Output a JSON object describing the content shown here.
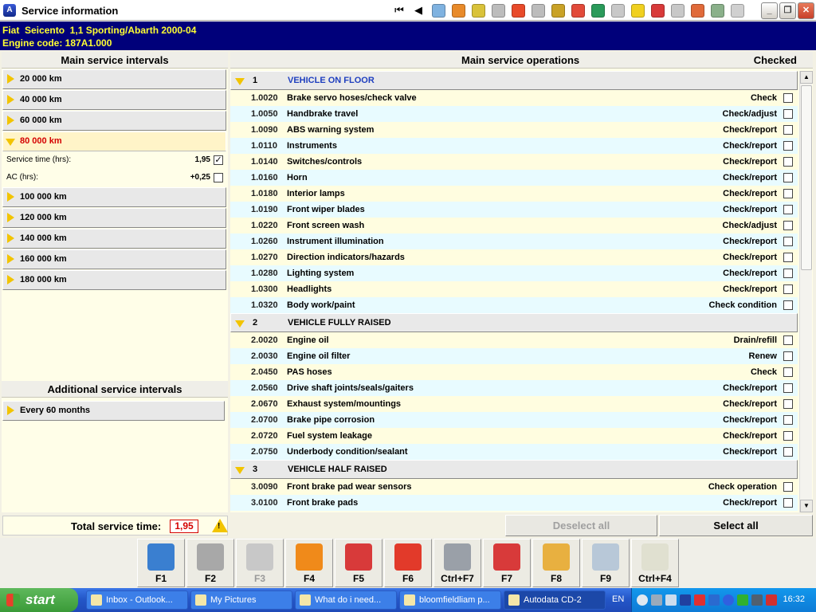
{
  "window": {
    "title": "Service information"
  },
  "toolbar": {
    "nav_first": "⏮",
    "nav_prev": "◀",
    "icons": [
      {
        "name": "engine-tech-icon",
        "color": "#7fb2e0"
      },
      {
        "name": "ignition-icon",
        "color": "#e88a2a"
      },
      {
        "name": "service-icon",
        "color": "#d9c23a"
      },
      {
        "name": "belt-icon",
        "color": "#bcbcbc"
      },
      {
        "name": "wheel-alignment-icon",
        "color": "#e84a2a"
      },
      {
        "name": "lift-icon",
        "color": "#bcbcbc"
      },
      {
        "name": "oil-icon",
        "color": "#c9a227"
      },
      {
        "name": "fault-codes-icon",
        "color": "#e24a3a"
      },
      {
        "name": "wiring-icon",
        "color": "#2a9a5a"
      },
      {
        "name": "tyre-icon",
        "color": "#c8c8c8"
      },
      {
        "name": "bulb-icon",
        "color": "#f0d020"
      },
      {
        "name": "repair-times-icon",
        "color": "#d83a3a"
      },
      {
        "name": "airbag-icon",
        "color": "#c8c8c8"
      },
      {
        "name": "aircon-icon",
        "color": "#e06a3a"
      },
      {
        "name": "battery-icon",
        "color": "#8ab08a"
      },
      {
        "name": "notes-icon",
        "color": "#d0d0d0"
      }
    ],
    "minimize": "_",
    "maximize": "❐",
    "close": "✕"
  },
  "vehicle": {
    "line1": "Fiat  Seicento  1,1 Sporting/Abarth 2000-04",
    "line2": "Engine code: 187A1.000"
  },
  "left": {
    "heading": "Main service intervals",
    "intervals_before": [
      {
        "label": "20 000 km"
      },
      {
        "label": "40 000 km"
      },
      {
        "label": "60 000 km"
      }
    ],
    "active_interval": {
      "label": "80 000 km",
      "service_time_label": "Service time (hrs):",
      "service_time_value": "1,95",
      "service_time_checked": "✓",
      "ac_label": "AC (hrs):",
      "ac_value": "+0,25"
    },
    "intervals_after": [
      {
        "label": "100 000 km"
      },
      {
        "label": "120 000 km"
      },
      {
        "label": "140 000 km"
      },
      {
        "label": "160 000 km"
      },
      {
        "label": "180 000 km"
      }
    ],
    "additional_heading": "Additional service intervals",
    "additional_items": [
      {
        "label": "Every 60 months"
      }
    ]
  },
  "right": {
    "heading": "Main service operations",
    "checked_heading": "Checked",
    "groups": [
      {
        "number": "1",
        "title": "VEHICLE ON FLOOR",
        "ops": [
          {
            "code": "1.0020",
            "name": "Brake servo hoses/check valve",
            "action": "Check"
          },
          {
            "code": "1.0050",
            "name": "Handbrake travel",
            "action": "Check/adjust"
          },
          {
            "code": "1.0090",
            "name": "ABS warning system",
            "action": "Check/report"
          },
          {
            "code": "1.0110",
            "name": "Instruments",
            "action": "Check/report"
          },
          {
            "code": "1.0140",
            "name": "Switches/controls",
            "action": "Check/report"
          },
          {
            "code": "1.0160",
            "name": "Horn",
            "action": "Check/report"
          },
          {
            "code": "1.0180",
            "name": "Interior lamps",
            "action": "Check/report"
          },
          {
            "code": "1.0190",
            "name": "Front wiper blades",
            "action": "Check/report"
          },
          {
            "code": "1.0220",
            "name": "Front screen wash",
            "action": "Check/adjust"
          },
          {
            "code": "1.0260",
            "name": "Instrument illumination",
            "action": "Check/report"
          },
          {
            "code": "1.0270",
            "name": "Direction indicators/hazards",
            "action": "Check/report"
          },
          {
            "code": "1.0280",
            "name": "Lighting system",
            "action": "Check/report"
          },
          {
            "code": "1.0300",
            "name": "Headlights",
            "action": "Check/report"
          },
          {
            "code": "1.0320",
            "name": "Body work/paint",
            "action": "Check condition"
          }
        ]
      },
      {
        "number": "2",
        "title": "VEHICLE FULLY RAISED",
        "ops": [
          {
            "code": "2.0020",
            "name": "Engine oil",
            "action": "Drain/refill"
          },
          {
            "code": "2.0030",
            "name": "Engine oil filter",
            "action": "Renew"
          },
          {
            "code": "2.0450",
            "name": "PAS hoses",
            "action": "Check"
          },
          {
            "code": "2.0560",
            "name": "Drive shaft joints/seals/gaiters",
            "action": "Check/report"
          },
          {
            "code": "2.0670",
            "name": "Exhaust system/mountings",
            "action": "Check/report"
          },
          {
            "code": "2.0700",
            "name": "Brake pipe corrosion",
            "action": "Check/report"
          },
          {
            "code": "2.0720",
            "name": "Fuel system leakage",
            "action": "Check/report"
          },
          {
            "code": "2.0750",
            "name": "Underbody condition/sealant",
            "action": "Check/report"
          }
        ]
      },
      {
        "number": "3",
        "title": "VEHICLE HALF RAISED",
        "ops": [
          {
            "code": "3.0090",
            "name": "Front brake pad wear sensors",
            "action": "Check operation"
          },
          {
            "code": "3.0100",
            "name": "Front brake pads",
            "action": "Check/report"
          }
        ]
      }
    ]
  },
  "bottom": {
    "total_label": "Total service time:",
    "total_value": "1,95",
    "deselect_label": "Deselect all",
    "select_label": "Select all"
  },
  "function_keys": [
    {
      "key": "F1",
      "icon": "help-icon",
      "color": "#3a7fd0"
    },
    {
      "key": "F2",
      "icon": "printer-icon",
      "color": "#a8a8a8"
    },
    {
      "key": "F3",
      "icon": "disabled-screen-icon",
      "color": "#c8c8c8"
    },
    {
      "key": "F4",
      "icon": "oil-can-icon",
      "color": "#f08a1a"
    },
    {
      "key": "F5",
      "icon": "vehicle-lift-icon",
      "color": "#d83a3a"
    },
    {
      "key": "F6",
      "icon": "ecu-icon",
      "color": "#e23a2a"
    },
    {
      "key": "Ctrl+F7",
      "icon": "gauge-icon",
      "color": "#9aa0a8"
    },
    {
      "key": "F7",
      "icon": "battery-icon",
      "color": "#d83a3a"
    },
    {
      "key": "F8",
      "icon": "parts-icon",
      "color": "#e8b040"
    },
    {
      "key": "F9",
      "icon": "timing-belt-icon",
      "color": "#b8c8d8"
    },
    {
      "key": "Ctrl+F4",
      "icon": "notes-edit-icon",
      "color": "#e0e0d0"
    }
  ],
  "taskbar": {
    "start_label": "start",
    "tasks": [
      {
        "label": "Inbox - Outlook..."
      },
      {
        "label": "My Pictures"
      },
      {
        "label": "What do i need..."
      },
      {
        "label": "bloomfieldliam p..."
      },
      {
        "label": "Autodata CD-2"
      }
    ],
    "language": "EN",
    "clock": "16:32"
  }
}
